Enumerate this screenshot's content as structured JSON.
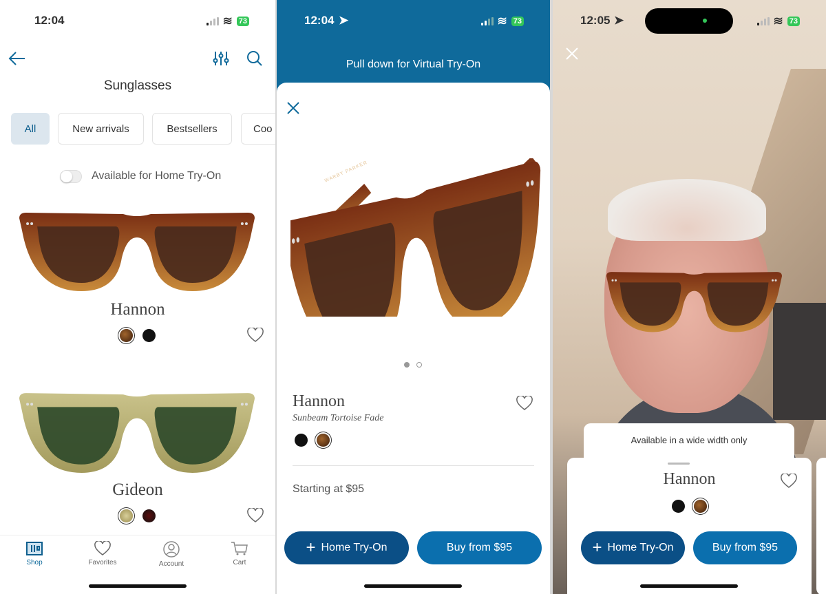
{
  "colors": {
    "accent": "#0f6a9b",
    "home_btn": "#0b4f86",
    "buy_btn": "#0b6fae",
    "battery": "#34c759"
  },
  "screen1": {
    "status": {
      "time": "12:04",
      "battery": "73"
    },
    "title": "Sunglasses",
    "chips": [
      {
        "label": "All",
        "selected": true
      },
      {
        "label": "New arrivals"
      },
      {
        "label": "Bestsellers"
      },
      {
        "label": "Coo"
      }
    ],
    "toggle": {
      "label": "Available for Home Try-On",
      "on": false
    },
    "products": [
      {
        "name": "Hannon",
        "swatches": [
          "tortoise",
          "black"
        ],
        "selected": 0
      },
      {
        "name": "Gideon",
        "swatches": [
          "olive crystal",
          "black red"
        ],
        "selected": 0
      }
    ],
    "tabs": [
      {
        "label": "Shop",
        "icon": "shop-icon",
        "active": true
      },
      {
        "label": "Favorites",
        "icon": "heart-icon"
      },
      {
        "label": "Account",
        "icon": "account-icon"
      },
      {
        "label": "Cart",
        "icon": "cart-icon"
      }
    ]
  },
  "screen2": {
    "status": {
      "time": "12:04",
      "battery": "73"
    },
    "banner": "Pull down for Virtual Try-On",
    "brand_on_frame": "WARBY PARKER",
    "product": {
      "name": "Hannon",
      "color": "Sunbeam Tortoise Fade",
      "price": "Starting at $95"
    },
    "pager": {
      "count": 2,
      "current": 1
    },
    "buttons": {
      "home": "Home Try-On",
      "buy": "Buy from $95"
    }
  },
  "screen3": {
    "status": {
      "time": "12:05",
      "battery": "73"
    },
    "notice": "Available in a wide width only",
    "product": {
      "name": "Hannon"
    },
    "buttons": {
      "home": "Home Try-On",
      "buy": "Buy from $95"
    }
  }
}
